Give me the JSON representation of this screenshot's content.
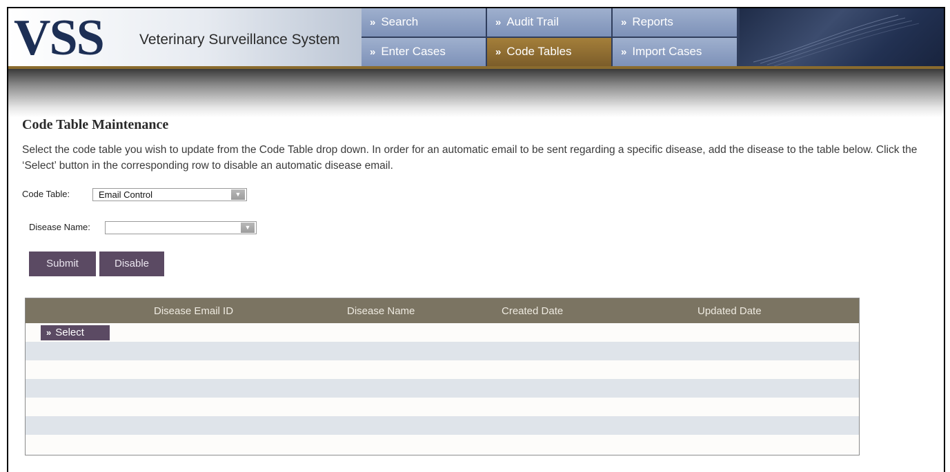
{
  "header": {
    "logo": "VSS",
    "system_name": "Veterinary Surveillance System",
    "nav": [
      {
        "label": "Search",
        "active": false
      },
      {
        "label": "Audit Trail",
        "active": false
      },
      {
        "label": "Reports",
        "active": false
      },
      {
        "label": "Enter Cases",
        "active": false
      },
      {
        "label": "Code Tables",
        "active": true
      },
      {
        "label": "Import Cases",
        "active": false
      }
    ],
    "nav_arrow": "»"
  },
  "main": {
    "title": "Code Table Maintenance",
    "instructions": "Select the code table you wish to update from the Code Table drop down.  In order for an automatic email to be sent regarding a specific disease, add the disease to the table below.  Click the ‘Select’ button in the corresponding row to disable an automatic disease email.",
    "code_table": {
      "label": "Code Table:",
      "value": "Email Control"
    },
    "disease_name": {
      "label": "Disease Name:",
      "value": ""
    },
    "submit_label": "Submit",
    "disable_label": "Disable"
  },
  "grid": {
    "columns": [
      "Disease Email ID",
      "Disease Name",
      "Created Date",
      "Updated Date"
    ],
    "select_label": "Select"
  },
  "colors": {
    "nav_active": "#8a6b2e",
    "button": "#5b4a63",
    "grid_header": "#7b7462",
    "alt_row": "#dfe4ea"
  }
}
